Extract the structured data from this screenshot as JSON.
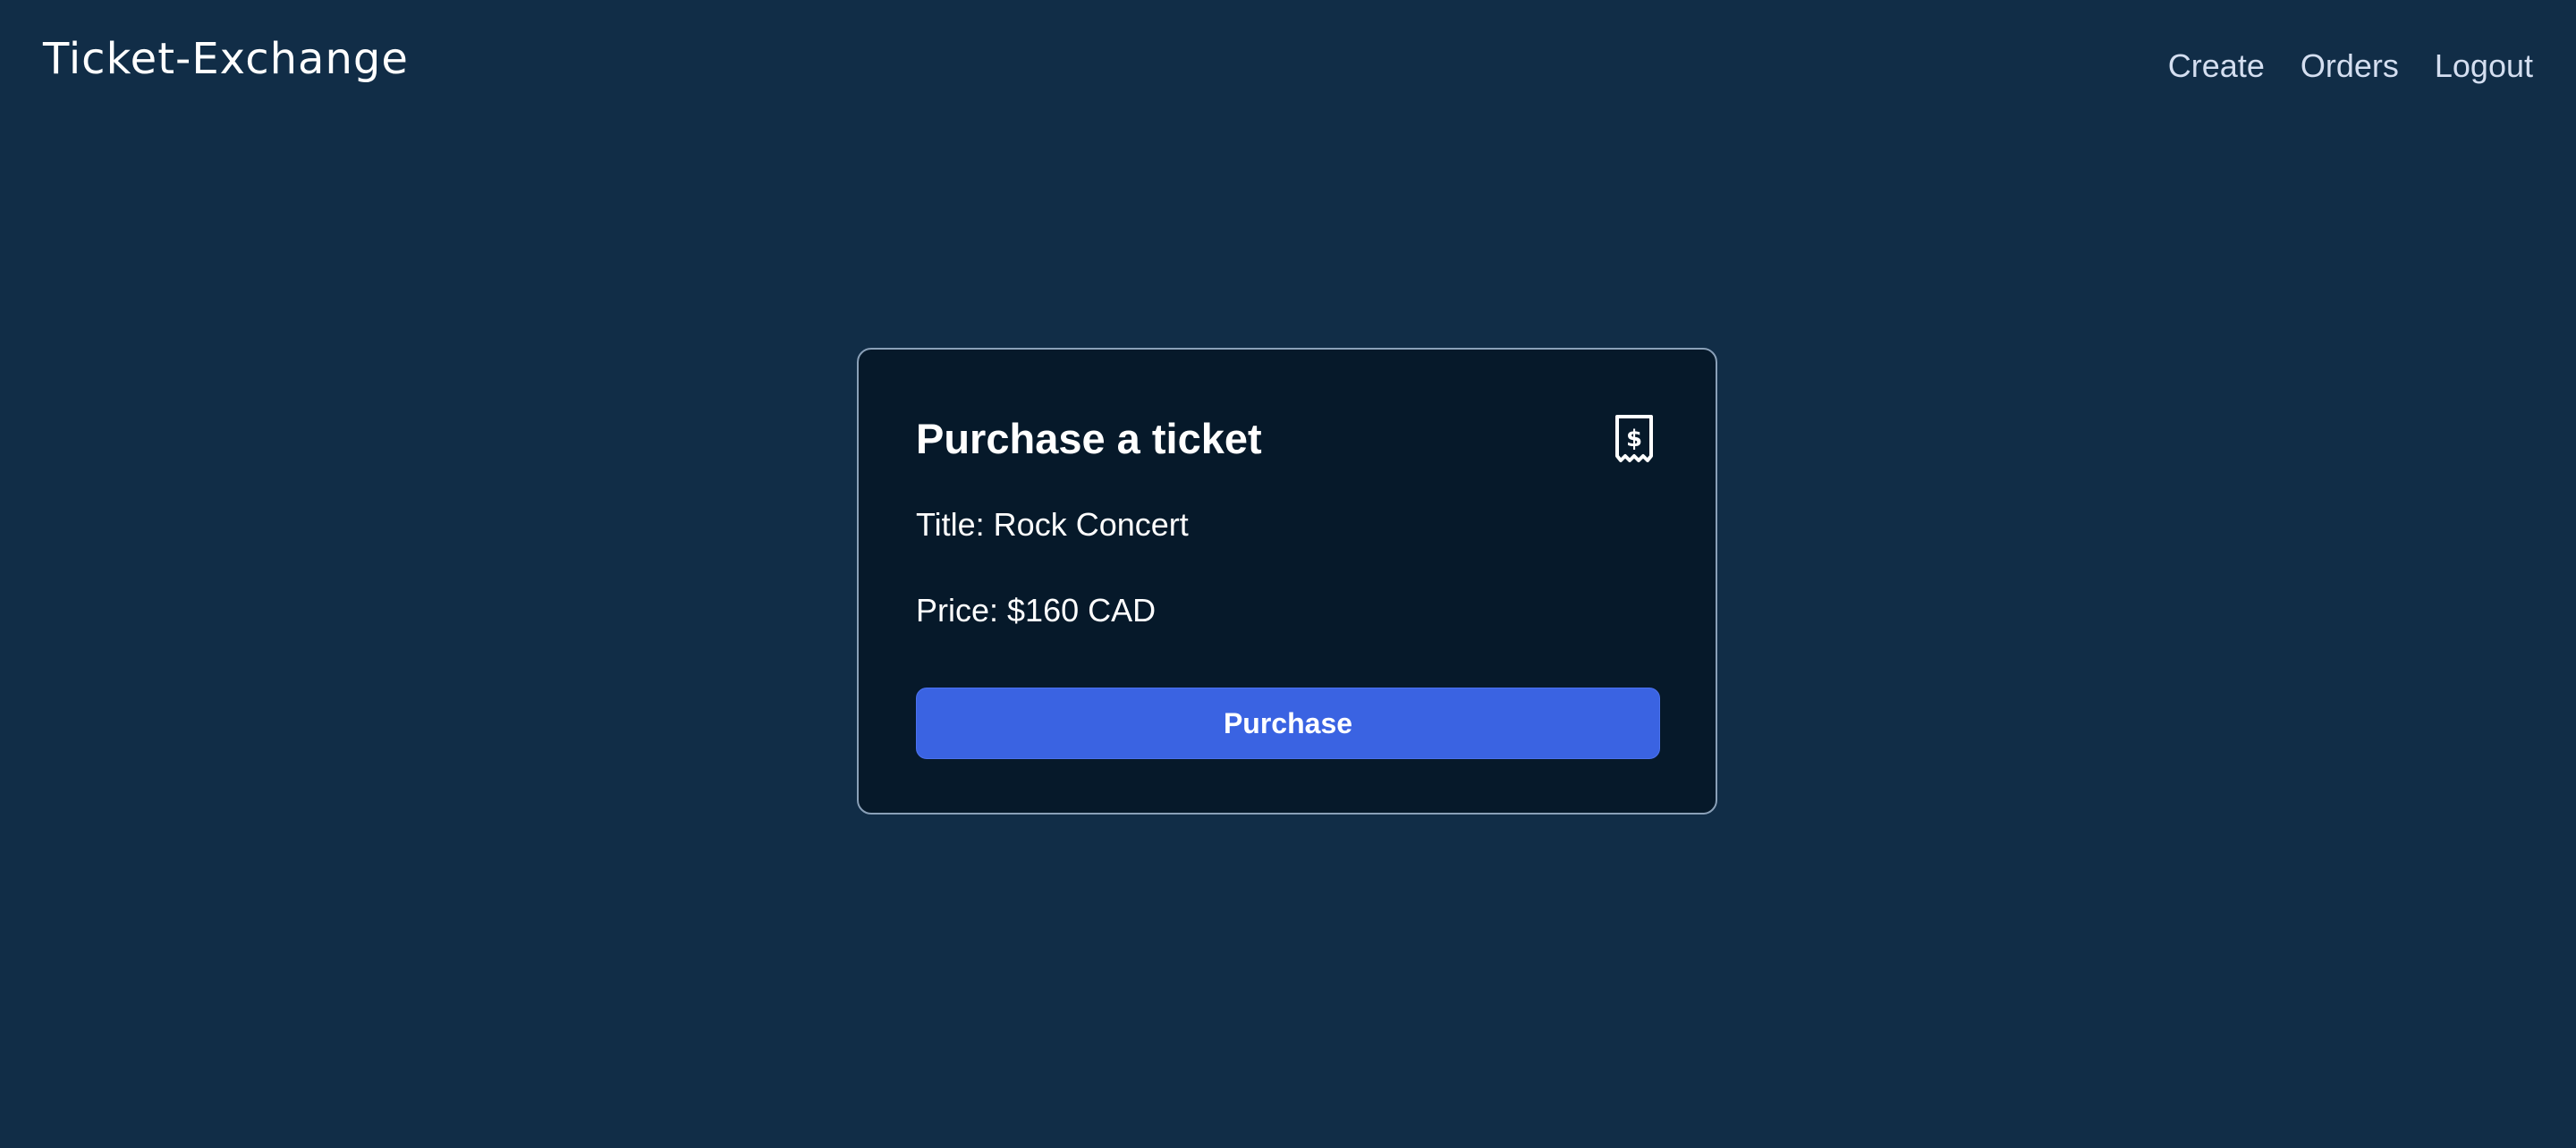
{
  "header": {
    "brand": "Ticket-Exchange",
    "nav": {
      "create_label": "Create",
      "orders_label": "Orders",
      "logout_label": "Logout"
    }
  },
  "card": {
    "title": "Purchase a ticket",
    "icon": "receipt-dollar-icon",
    "ticket_title_line": "Title: Rock Concert",
    "price_line": "Price: $160 CAD",
    "purchase_label": "Purchase"
  },
  "colors": {
    "page_background": "#112d47",
    "card_background": "#06192a",
    "card_border": "#8aa0b8",
    "button_primary": "#3a63e2",
    "nav_text": "#d4def0"
  }
}
